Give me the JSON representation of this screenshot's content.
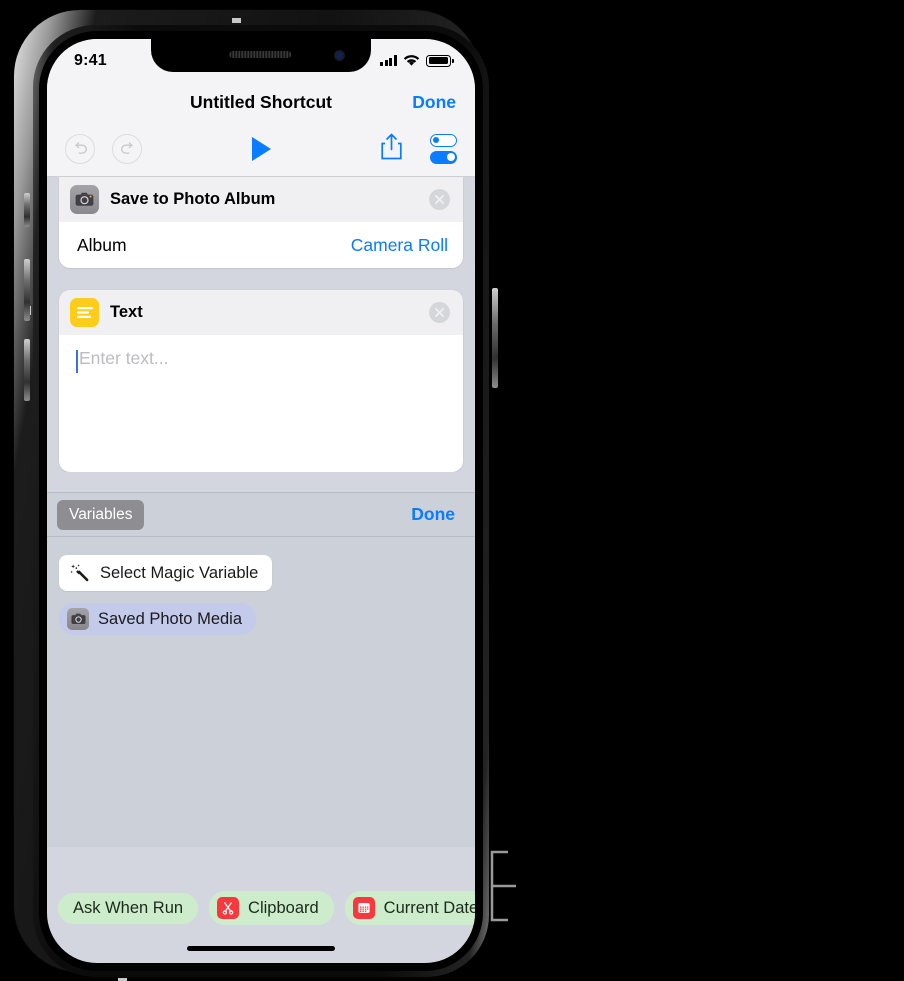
{
  "status_bar": {
    "time": "9:41",
    "signal_icon": "cellular-bars-icon",
    "wifi_icon": "wifi-icon",
    "battery_icon": "battery-icon"
  },
  "nav": {
    "title": "Untitled Shortcut",
    "done_label": "Done"
  },
  "toolbar": {
    "undo_icon": "undo-arrow-icon",
    "redo_icon": "redo-arrow-icon",
    "play_icon": "play-triangle-icon",
    "share_icon": "share-up-arrow-icon",
    "settings_icon": "toggles-settings-icon"
  },
  "actions": [
    {
      "icon": "camera-icon",
      "title": "Save to Photo Album",
      "delete_icon": "close-circle-icon",
      "row_label": "Album",
      "row_value": "Camera Roll"
    },
    {
      "icon": "text-lines-icon",
      "title": "Text",
      "delete_icon": "close-circle-icon",
      "placeholder": "Enter text..."
    }
  ],
  "variables_panel": {
    "tab_label": "Variables",
    "done_label": "Done",
    "items": [
      {
        "icon": "magic-wand-icon",
        "label": "Select Magic Variable",
        "style": "white"
      },
      {
        "icon": "camera-icon",
        "label": "Saved Photo Media",
        "style": "lavender"
      }
    ]
  },
  "suggestions": [
    {
      "label": "Ask When Run",
      "icon": null
    },
    {
      "label": "Clipboard",
      "icon": "scissors-icon"
    },
    {
      "label": "Current Date",
      "icon": "calendar-icon"
    }
  ],
  "colors": {
    "accent_blue": "#0a7cff",
    "screen_bg": "#d3d6de",
    "chrome_bg": "#f4f4f6",
    "card_head": "#f0f0f2",
    "keyboard_bg": "#ccd0d9",
    "variable_pill": "#c4caea",
    "suggestion_pill": "#cceccc",
    "text_icon_yellow": "#ffcc1a",
    "red_icon": "#f8383f"
  }
}
